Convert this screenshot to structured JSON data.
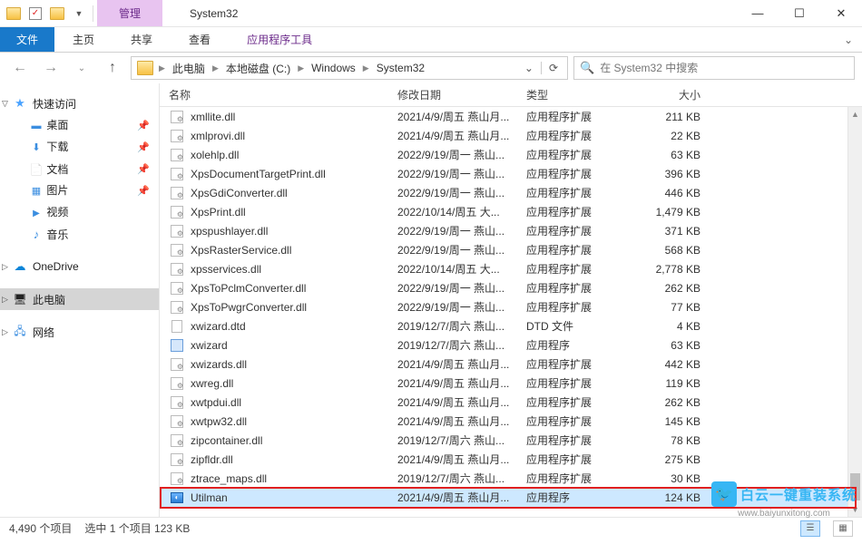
{
  "window": {
    "title": "System32",
    "ctx_tab": "管理",
    "minimize": "—",
    "maximize": "☐",
    "close": "✕"
  },
  "ribbon": {
    "file": "文件",
    "tabs": [
      "主页",
      "共享",
      "查看"
    ],
    "ctx_sub": "应用程序工具",
    "expand": "⌄"
  },
  "nav": {
    "back": "←",
    "forward": "→",
    "recent": "⌄",
    "up": "↑",
    "crumbs": [
      "此电脑",
      "本地磁盘 (C:)",
      "Windows",
      "System32"
    ],
    "refresh": "⟳",
    "search_placeholder": "在 System32 中搜索"
  },
  "sidebar": {
    "quick": {
      "label": "快速访问",
      "items": [
        {
          "label": "桌面",
          "icon": "desktop"
        },
        {
          "label": "下载",
          "icon": "download"
        },
        {
          "label": "文档",
          "icon": "doc"
        },
        {
          "label": "图片",
          "icon": "pic"
        },
        {
          "label": "视频",
          "icon": "video"
        },
        {
          "label": "音乐",
          "icon": "music"
        }
      ]
    },
    "onedrive": "OneDrive",
    "thispc": "此电脑",
    "network": "网络"
  },
  "columns": {
    "name": "名称",
    "date": "修改日期",
    "type": "类型",
    "size": "大小"
  },
  "files": [
    {
      "name": "xmllite.dll",
      "date": "2021/4/9/周五 燕山月...",
      "type": "应用程序扩展",
      "size": "211 KB",
      "icon": "dll"
    },
    {
      "name": "xmlprovi.dll",
      "date": "2021/4/9/周五 燕山月...",
      "type": "应用程序扩展",
      "size": "22 KB",
      "icon": "dll"
    },
    {
      "name": "xolehlp.dll",
      "date": "2022/9/19/周一 燕山...",
      "type": "应用程序扩展",
      "size": "63 KB",
      "icon": "dll"
    },
    {
      "name": "XpsDocumentTargetPrint.dll",
      "date": "2022/9/19/周一 燕山...",
      "type": "应用程序扩展",
      "size": "396 KB",
      "icon": "dll"
    },
    {
      "name": "XpsGdiConverter.dll",
      "date": "2022/9/19/周一 燕山...",
      "type": "应用程序扩展",
      "size": "446 KB",
      "icon": "dll"
    },
    {
      "name": "XpsPrint.dll",
      "date": "2022/10/14/周五 大...",
      "type": "应用程序扩展",
      "size": "1,479 KB",
      "icon": "dll"
    },
    {
      "name": "xpspushlayer.dll",
      "date": "2022/9/19/周一 燕山...",
      "type": "应用程序扩展",
      "size": "371 KB",
      "icon": "dll"
    },
    {
      "name": "XpsRasterService.dll",
      "date": "2022/9/19/周一 燕山...",
      "type": "应用程序扩展",
      "size": "568 KB",
      "icon": "dll"
    },
    {
      "name": "xpsservices.dll",
      "date": "2022/10/14/周五 大...",
      "type": "应用程序扩展",
      "size": "2,778 KB",
      "icon": "dll"
    },
    {
      "name": "XpsToPclmConverter.dll",
      "date": "2022/9/19/周一 燕山...",
      "type": "应用程序扩展",
      "size": "262 KB",
      "icon": "dll"
    },
    {
      "name": "XpsToPwgrConverter.dll",
      "date": "2022/9/19/周一 燕山...",
      "type": "应用程序扩展",
      "size": "77 KB",
      "icon": "dll"
    },
    {
      "name": "xwizard.dtd",
      "date": "2019/12/7/周六 燕山...",
      "type": "DTD 文件",
      "size": "4 KB",
      "icon": "dtd"
    },
    {
      "name": "xwizard",
      "date": "2019/12/7/周六 燕山...",
      "type": "应用程序",
      "size": "63 KB",
      "icon": "exe"
    },
    {
      "name": "xwizards.dll",
      "date": "2021/4/9/周五 燕山月...",
      "type": "应用程序扩展",
      "size": "442 KB",
      "icon": "dll"
    },
    {
      "name": "xwreg.dll",
      "date": "2021/4/9/周五 燕山月...",
      "type": "应用程序扩展",
      "size": "119 KB",
      "icon": "dll"
    },
    {
      "name": "xwtpdui.dll",
      "date": "2021/4/9/周五 燕山月...",
      "type": "应用程序扩展",
      "size": "262 KB",
      "icon": "dll"
    },
    {
      "name": "xwtpw32.dll",
      "date": "2021/4/9/周五 燕山月...",
      "type": "应用程序扩展",
      "size": "145 KB",
      "icon": "dll"
    },
    {
      "name": "zipcontainer.dll",
      "date": "2019/12/7/周六 燕山...",
      "type": "应用程序扩展",
      "size": "78 KB",
      "icon": "dll"
    },
    {
      "name": "zipfldr.dll",
      "date": "2021/4/9/周五 燕山月...",
      "type": "应用程序扩展",
      "size": "275 KB",
      "icon": "dll"
    },
    {
      "name": "ztrace_maps.dll",
      "date": "2019/12/7/周六 燕山...",
      "type": "应用程序扩展",
      "size": "30 KB",
      "icon": "dll"
    },
    {
      "name": "Utilman",
      "date": "2021/4/9/周五 燕山月...",
      "type": "应用程序",
      "size": "124 KB",
      "icon": "exe-blue",
      "selected": true,
      "highlight": true
    }
  ],
  "status": {
    "count": "4,490 个项目",
    "selection": "选中 1 个项目  123 KB"
  },
  "watermark": {
    "text": "白云一键重装系统",
    "url": "www.baiyunxitong.com"
  }
}
